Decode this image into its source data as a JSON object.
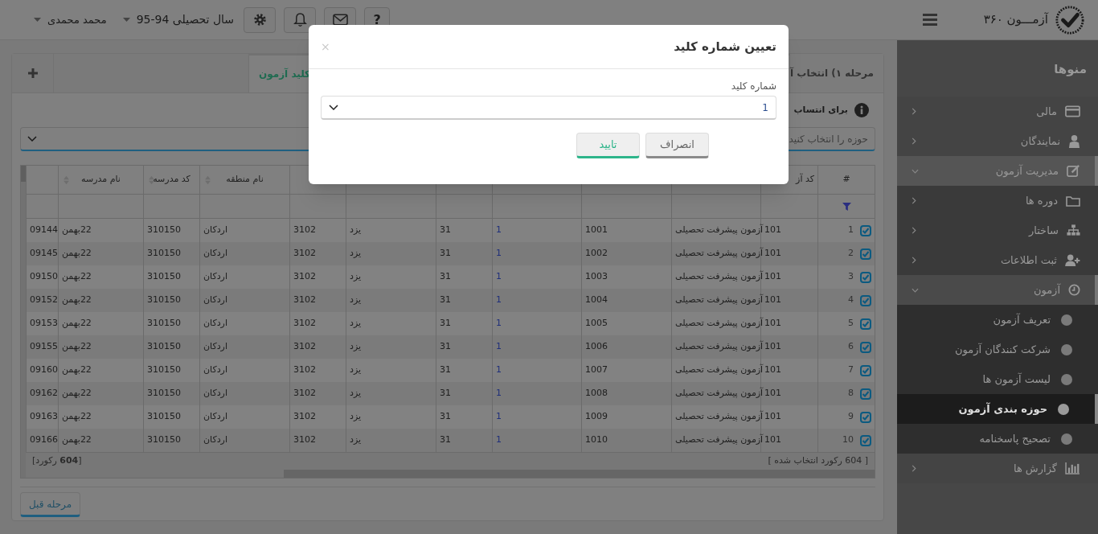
{
  "header": {
    "app_title": "آزمـــون ۳۶۰",
    "toolbar": [
      {
        "kind": "help",
        "label": "?"
      },
      {
        "kind": "mail"
      },
      {
        "kind": "bell"
      },
      {
        "kind": "gear"
      }
    ],
    "academic_year": "سال تحصیلی 94-95",
    "user_name": "محمد محمدی"
  },
  "sidebar": {
    "title": "منوها",
    "items": [
      {
        "label": "مالی",
        "expanded": false
      },
      {
        "label": "نمایندگان",
        "expanded": false
      },
      {
        "label": "مدیریت آزمون",
        "expanded": true,
        "children": [
          {
            "label": "دوره ها",
            "expanded": false
          },
          {
            "label": "ساختار",
            "expanded": false
          },
          {
            "label": "ثبت اطلاعات",
            "expanded": false
          },
          {
            "label": "آزمون",
            "expanded": true,
            "children": [
              {
                "label": "تعریف آزمون",
                "selected": false
              },
              {
                "label": "شرکت کنندگان آزمون",
                "selected": false
              },
              {
                "label": "لیست آزمون ها",
                "selected": false
              },
              {
                "label": "حوزه بندی آزمون",
                "selected": true
              },
              {
                "label": "تصحیح پاسخنامه",
                "selected": false
              }
            ]
          }
        ]
      },
      {
        "label": "گزارش ها",
        "expanded": false
      }
    ]
  },
  "main": {
    "tabs": [
      {
        "label": "مرحله ۱) انتخاب آ",
        "selected": false
      },
      {
        "label": "کلید آزمون",
        "selected": true
      }
    ],
    "info_text": "برای انتساب",
    "zone_select": {
      "placeholder": "حوزه را انتخاب کنید"
    },
    "table": {
      "columns": [
        {
          "label": "#"
        },
        {
          "label": "کد آز"
        },
        {},
        {},
        {},
        {},
        {},
        {},
        {
          "label": "نام منطقه"
        },
        {
          "label": "کد مدرسه"
        },
        {
          "label": "نام مدرسه"
        },
        {}
      ],
      "rows": [
        {
          "checked": true,
          "cells": [
            "1",
            "101",
            "آزمون پیشرفت تحصیلی",
            "1001",
            "1",
            "31",
            "یزد",
            "3102",
            "اردکان",
            "310150",
            "22بهمن",
            "09144"
          ]
        },
        {
          "checked": true,
          "cells": [
            "2",
            "101",
            "آزمون پیشرفت تحصیلی",
            "1002",
            "1",
            "31",
            "یزد",
            "3102",
            "اردکان",
            "310150",
            "22بهمن",
            "09145"
          ]
        },
        {
          "checked": true,
          "cells": [
            "3",
            "101",
            "آزمون پیشرفت تحصیلی",
            "1003",
            "1",
            "31",
            "یزد",
            "3102",
            "اردکان",
            "310150",
            "22بهمن",
            "09150"
          ]
        },
        {
          "checked": true,
          "cells": [
            "4",
            "101",
            "آزمون پیشرفت تحصیلی",
            "1004",
            "1",
            "31",
            "یزد",
            "3102",
            "اردکان",
            "310150",
            "22بهمن",
            "09152"
          ]
        },
        {
          "checked": true,
          "cells": [
            "5",
            "101",
            "آزمون پیشرفت تحصیلی",
            "1005",
            "1",
            "31",
            "یزد",
            "3102",
            "اردکان",
            "310150",
            "22بهمن",
            "09153"
          ]
        },
        {
          "checked": true,
          "cells": [
            "6",
            "101",
            "آزمون پیشرفت تحصیلی",
            "1006",
            "1",
            "31",
            "یزد",
            "3102",
            "اردکان",
            "310150",
            "22بهمن",
            "09155"
          ]
        },
        {
          "checked": true,
          "cells": [
            "7",
            "101",
            "آزمون پیشرفت تحصیلی",
            "1007",
            "1",
            "31",
            "یزد",
            "3102",
            "اردکان",
            "310150",
            "22بهمن",
            "09160"
          ]
        },
        {
          "checked": true,
          "cells": [
            "8",
            "101",
            "آزمون پیشرفت تحصیلی",
            "1008",
            "1",
            "31",
            "یزد",
            "3102",
            "اردکان",
            "310150",
            "22بهمن",
            "09162"
          ]
        },
        {
          "checked": true,
          "cells": [
            "9",
            "101",
            "آزمون پیشرفت تحصیلی",
            "1009",
            "1",
            "31",
            "یزد",
            "3102",
            "اردکان",
            "310150",
            "22بهمن",
            "09163"
          ]
        },
        {
          "checked": true,
          "cells": [
            "10",
            "101",
            "آزمون پیشرفت تحصیلی",
            "1010",
            "1",
            "31",
            "یزد",
            "3102",
            "اردکان",
            "310150",
            "22بهمن",
            "09166"
          ]
        }
      ],
      "selected_count": "[ 604 رکورد انتخاب شده ]",
      "total": "[**604** رکورد]"
    },
    "back_button": "مرحله قبل"
  },
  "modal": {
    "title": "تعیین شماره کلید",
    "close_label": "×",
    "field_label": "شماره کلید",
    "field_value": "1",
    "buttons": [
      {
        "kind": "cancel",
        "label": "انصراف"
      },
      {
        "kind": "confirm",
        "label": "تایید"
      }
    ]
  }
}
